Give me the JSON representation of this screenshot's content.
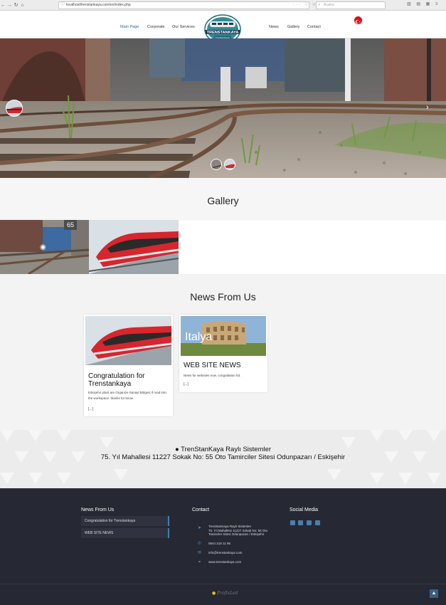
{
  "browser": {
    "url": "localhost/trenstankaya.com/en/index.php",
    "search_placeholder": "Arama"
  },
  "nav": {
    "left": [
      "Main Page",
      "Corporate",
      "Our Services"
    ],
    "right": [
      "News",
      "Gallery",
      "Contact"
    ],
    "logo_text": "TRENSTANKAYA",
    "logo_subtext": "Trenstankaya"
  },
  "gallery": {
    "title": "Gallery",
    "badge": "65"
  },
  "news": {
    "title": "News From Us",
    "cards": [
      {
        "title": "Congratulation for Trenstankaya",
        "body": "Eskişehir plant are Organize Sanayi Bölgesi if road into the workspace. thanks for know.",
        "more": "[...]"
      },
      {
        "image_text": "Italya",
        "title": "WEB SITE NEWS",
        "body": "News for websites now. congralation hd.",
        "more": "[...]"
      }
    ]
  },
  "address": {
    "company": "TrenStanKaya Raylı Sistemler",
    "line": "75. Yıl Mahallesi 11227 Sokak No: 55 Oto Tamirciler Sitesi Odunpazarı / Eskişehir"
  },
  "footer": {
    "news_title": "News From Us",
    "news_items": [
      "Congratulation for Trenstankaya",
      "WEB SITE NEWS"
    ],
    "contact_title": "Contact",
    "contact_company": "TrenStanKaya Raylı Sistemler",
    "contact_address": "75. Yıl Mahallesi 11227 Sokak No: 55 Oto Tamirciler Sitesi Odunpazarı / Eskişehir",
    "phone": "0544 218 11 96",
    "email": "info@trenstankaya.com",
    "web": "www.trenstankaya.com",
    "social_title": "Social Media",
    "brand": "ProfixLed"
  },
  "colors": {
    "accent": "#2a6a9a",
    "footer_bg": "#262834",
    "train_red": "#d6262e"
  }
}
